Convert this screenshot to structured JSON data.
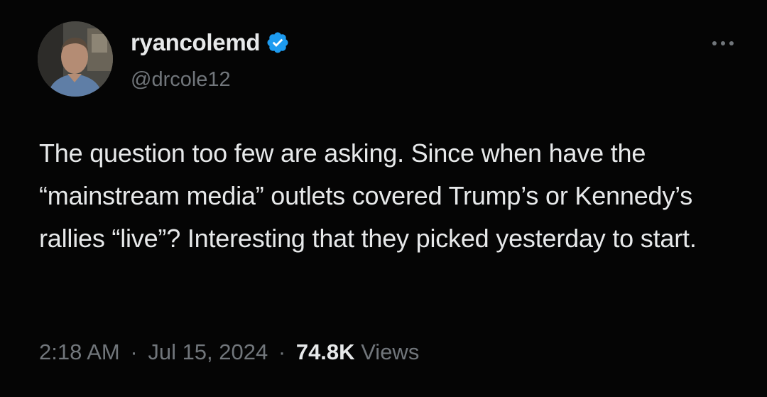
{
  "tweet": {
    "display_name": "ryancolemd",
    "handle": "@drcole12",
    "verified_icon": "verified-badge-icon",
    "more_icon": "more-options-icon",
    "text": "The question too few are asking. Since when have the “mainstream media” outlets covered Trump’s or Kennedy’s rallies “live”? Interesting that they picked yesterday to start.",
    "time": "2:18 AM",
    "separator": "·",
    "date": "Jul 15, 2024",
    "views_count": "74.8K",
    "views_label": "Views"
  },
  "colors": {
    "background": "#050505",
    "primary_text": "#e7e9ea",
    "secondary_text": "#71767b",
    "verified_blue": "#1d9bf0"
  }
}
